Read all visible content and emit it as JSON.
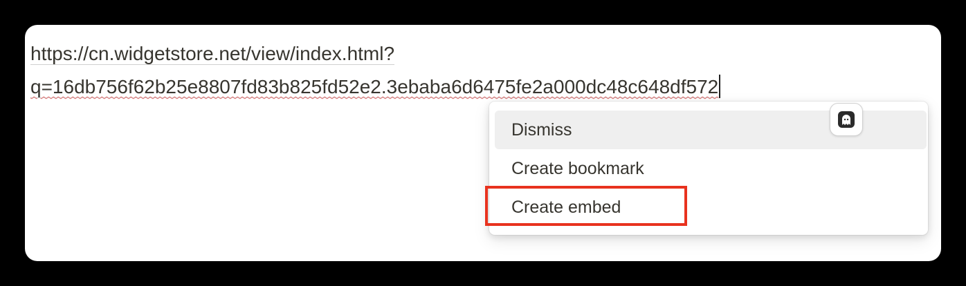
{
  "editor": {
    "url_line1": "https://cn.widgetstore.net/view/index.html?",
    "url_line2": "q=16db756f62b25e8807fd83b825fd52e2.3ebaba6d6475fe2a000dc48c648df572"
  },
  "paste_menu": {
    "items": [
      {
        "label": "Dismiss",
        "state": "hovered"
      },
      {
        "label": "Create bookmark"
      },
      {
        "label": "Create embed",
        "highlighted": true
      }
    ]
  },
  "colors": {
    "highlight": "#e8321e",
    "hover_bg": "#efefef",
    "text": "#37352f",
    "spellcheck": "#e06c6c"
  },
  "extension": {
    "icon": "ghost-extension-icon"
  }
}
